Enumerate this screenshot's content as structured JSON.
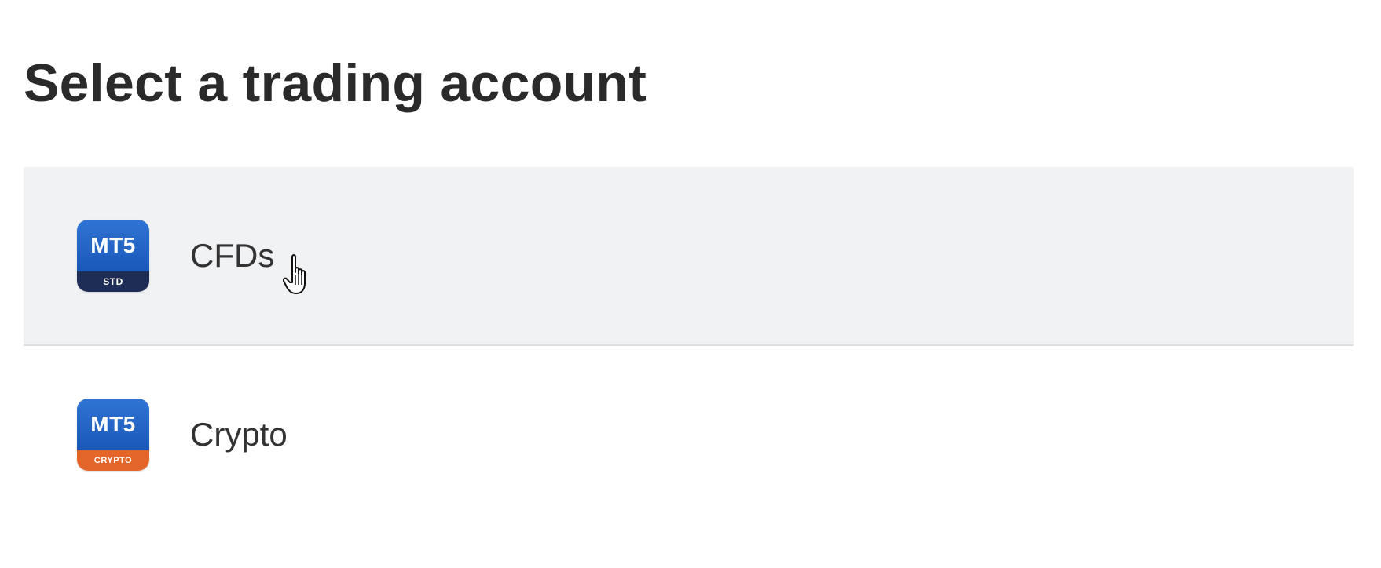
{
  "page": {
    "title": "Select a trading account"
  },
  "accounts": [
    {
      "label": "CFDs",
      "badge_main": "MT5",
      "badge_sub": "STD",
      "badge_sub_color": "#1d2d55",
      "selected": true,
      "icon": "mt5-std-icon"
    },
    {
      "label": "Crypto",
      "badge_main": "MT5",
      "badge_sub": "CRYPTO",
      "badge_sub_color": "#e4652a",
      "selected": false,
      "icon": "mt5-crypto-icon"
    }
  ],
  "colors": {
    "badge_blue": "#1a58b8",
    "selected_row_bg": "#f1f2f4",
    "title_text": "#2a2a2a"
  },
  "cursor": {
    "icon": "hand-pointer-icon"
  }
}
